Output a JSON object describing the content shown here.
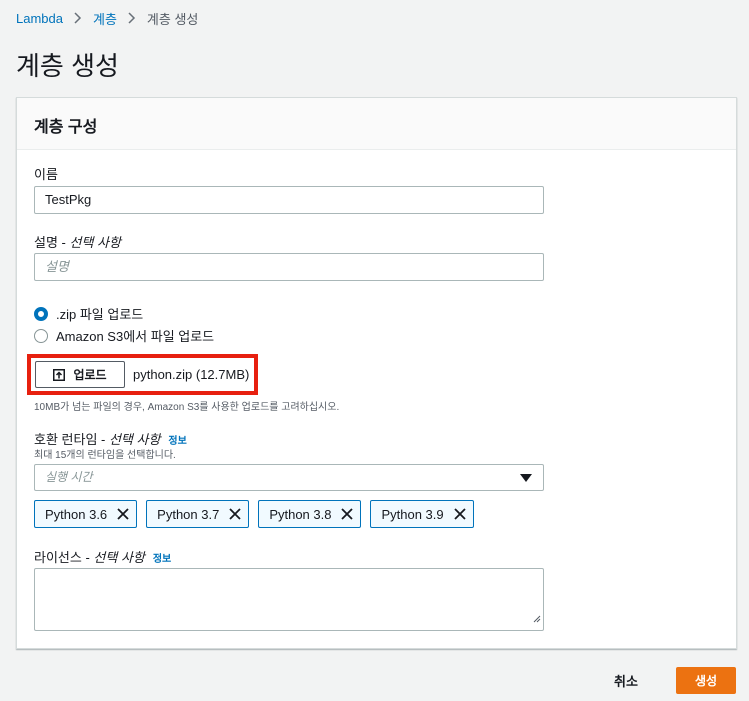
{
  "breadcrumb": [
    "Lambda",
    "계층",
    "계층 생성"
  ],
  "page_title": "계층 생성",
  "panel": {
    "title": "계층 구성",
    "name_label": "이름",
    "name_value": "TestPkg",
    "desc_label": "설명 - ",
    "desc_optional": "선택 사항",
    "desc_placeholder": "설명",
    "upload_options": [
      ".zip 파일 업로드",
      "Amazon S3에서 파일 업로드"
    ],
    "selected_upload_option": 0,
    "upload_button": "업로드",
    "file_name": "python.zip (12.7MB)",
    "upload_hint": "10MB가 넘는 파일의 경우, Amazon S3를 사용한 업로드를 고려하십시오.",
    "runtime_label": "호환 런타임 - ",
    "runtime_optional": "선택 사항",
    "runtime_info": "정보",
    "runtime_hint": "최대 15개의 런타임을 선택합니다.",
    "runtime_placeholder": "실행 시간",
    "runtimes": [
      "Python 3.6",
      "Python 3.7",
      "Python 3.8",
      "Python 3.9"
    ],
    "license_label": "라이선스 - ",
    "license_optional": "선택 사항",
    "license_info": "정보"
  },
  "actions": {
    "cancel": "취소",
    "create": "생성"
  },
  "colors": {
    "accent": "#ec7211",
    "link": "#0073bb",
    "highlight": "#e7200f"
  }
}
